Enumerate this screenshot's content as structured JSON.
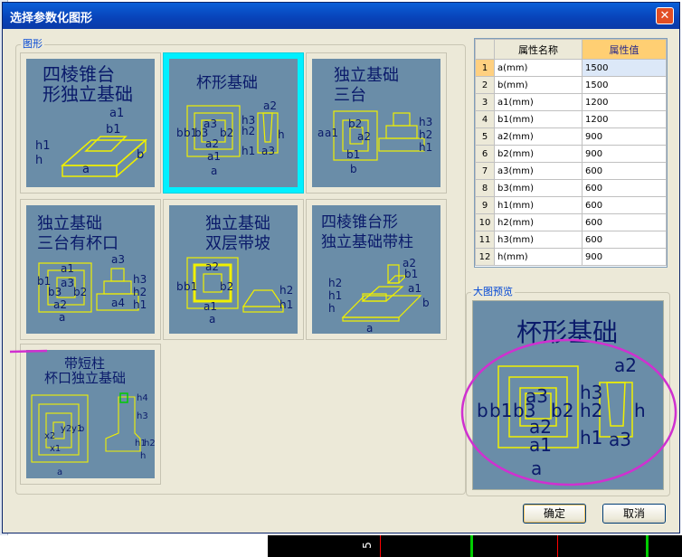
{
  "dialog": {
    "title": "选择参数化图形"
  },
  "groups": {
    "shapes_label": "图形",
    "preview_label": "大图预览"
  },
  "tiles": [
    {
      "id": "t1",
      "title_lines": [
        "四棱锥台",
        "形独立基础"
      ],
      "labels": [
        "a1",
        "b1",
        "h1",
        "h",
        "a",
        "b"
      ]
    },
    {
      "id": "t2",
      "title_lines": [
        "杯形基础"
      ],
      "labels": [
        "a2",
        "h3",
        "h2",
        "h",
        "h1",
        "a3",
        "b",
        "b1",
        "b3",
        "a3",
        "a2",
        "b2",
        "a1",
        "a"
      ]
    },
    {
      "id": "t3",
      "title_lines": [
        "独立基础",
        "三台"
      ],
      "labels": [
        "a",
        "a1",
        "b2",
        "a2",
        "b1",
        "b",
        "h3",
        "h2",
        "h1"
      ]
    },
    {
      "id": "t4",
      "title_lines": [
        "独立基础",
        "三台有杯口"
      ],
      "labels": [
        "a1",
        "a3",
        "b1",
        "a3",
        "b3",
        "b2",
        "a2",
        "a",
        "h3",
        "h2",
        "h1",
        "a4"
      ]
    },
    {
      "id": "t5",
      "title_lines": [
        "独立基础",
        "双层带坡"
      ],
      "labels": [
        "a2",
        "b",
        "b1",
        "b2",
        "a1",
        "a",
        "h2",
        "h1"
      ]
    },
    {
      "id": "t6",
      "title_lines": [
        "四棱锥台形",
        "独立基础带柱"
      ],
      "labels": [
        "a2",
        "b1",
        "h2",
        "h1",
        "h",
        "a1",
        "b",
        "a"
      ]
    },
    {
      "id": "t7",
      "title_lines": [
        "带短柱",
        "杯口独立基础"
      ],
      "labels": [
        "x2",
        "x1",
        "y2",
        "y1",
        "b",
        "a",
        "h4",
        "h3",
        "h1",
        "h2",
        "h"
      ]
    }
  ],
  "table": {
    "headers": [
      "属性名称",
      "属性值"
    ],
    "rows": [
      {
        "n": "1",
        "name": "a(mm)",
        "value": "1500"
      },
      {
        "n": "2",
        "name": "b(mm)",
        "value": "1500"
      },
      {
        "n": "3",
        "name": "a1(mm)",
        "value": "1200"
      },
      {
        "n": "4",
        "name": "b1(mm)",
        "value": "1200"
      },
      {
        "n": "5",
        "name": "a2(mm)",
        "value": "900"
      },
      {
        "n": "6",
        "name": "b2(mm)",
        "value": "900"
      },
      {
        "n": "7",
        "name": "a3(mm)",
        "value": "600"
      },
      {
        "n": "8",
        "name": "b3(mm)",
        "value": "600"
      },
      {
        "n": "9",
        "name": "h1(mm)",
        "value": "600"
      },
      {
        "n": "10",
        "name": "h2(mm)",
        "value": "600"
      },
      {
        "n": "11",
        "name": "h3(mm)",
        "value": "600"
      },
      {
        "n": "12",
        "name": "h(mm)",
        "value": "900"
      }
    ]
  },
  "preview": {
    "title": "杯形基础",
    "labels": [
      "a2",
      "b",
      "b1",
      "b3",
      "a3",
      "b2",
      "a2",
      "a1",
      "a",
      "h3",
      "h2",
      "h",
      "h1",
      "a3"
    ]
  },
  "buttons": {
    "ok": "确定",
    "cancel": "取消"
  },
  "background": {
    "axis_label": "5"
  },
  "colors": {
    "tile_bg": "#6a8da8",
    "line": "#f0f000",
    "text": "#0a1a6a",
    "selection": "#00f0ff",
    "annotation": "#d030d0"
  }
}
